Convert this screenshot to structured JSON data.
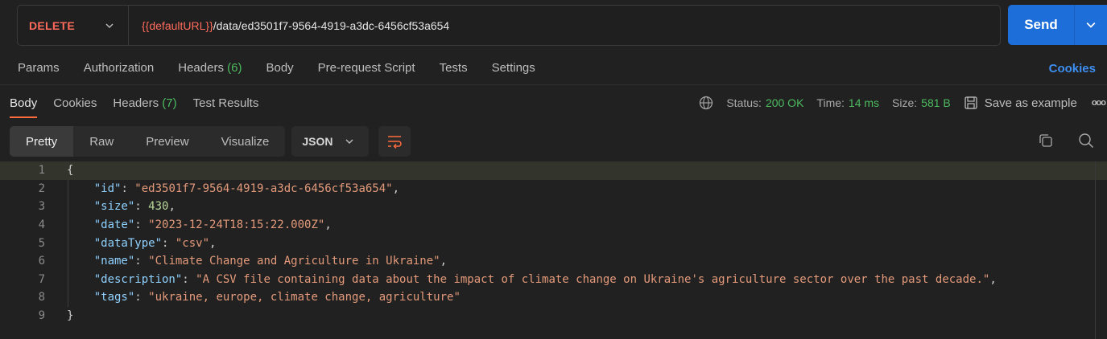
{
  "request": {
    "method": "DELETE",
    "url_variable": "{{defaultURL}}",
    "url_path": "/data/ed3501f7-9564-4919-a3dc-6456cf53a654",
    "send_label": "Send"
  },
  "request_tabs": {
    "params": "Params",
    "authorization": "Authorization",
    "headers": "Headers",
    "headers_count": "(6)",
    "body": "Body",
    "prerequest": "Pre-request Script",
    "tests": "Tests",
    "settings": "Settings",
    "cookies": "Cookies"
  },
  "response_tabs": {
    "body": "Body",
    "cookies": "Cookies",
    "headers": "Headers",
    "headers_count": "(7)",
    "test_results": "Test Results"
  },
  "response_meta": {
    "status_label": "Status:",
    "status_value": "200 OK",
    "time_label": "Time:",
    "time_value": "14 ms",
    "size_label": "Size:",
    "size_value": "581 B",
    "save_example": "Save as example",
    "more": "ooo"
  },
  "view_modes": [
    "Pretty",
    "Raw",
    "Preview",
    "Visualize"
  ],
  "format": "JSON",
  "icons": {
    "method_dropdown": "chevron-down-icon",
    "send_dropdown": "chevron-down-icon",
    "globe": "globe-icon",
    "save": "save-icon",
    "wrap": "wrap-lines-icon",
    "copy": "copy-icon",
    "search": "search-icon"
  },
  "colors": {
    "accent_blue": "#1d6ed8",
    "method_red": "#ff6b5b",
    "success_green": "#4dbb5f",
    "active_tab_underline": "#ff6b3d"
  },
  "code": {
    "line_numbers": [
      "1",
      "2",
      "3",
      "4",
      "5",
      "6",
      "7",
      "8",
      "9"
    ],
    "open_brace": "{",
    "close_brace": "}",
    "fields": [
      {
        "key": "\"id\"",
        "value": "\"ed3501f7-9564-4919-a3dc-6456cf53a654\"",
        "type": "string",
        "comma": ","
      },
      {
        "key": "\"size\"",
        "value": "430",
        "type": "number",
        "comma": ","
      },
      {
        "key": "\"date\"",
        "value": "\"2023-12-24T18:15:22.000Z\"",
        "type": "string",
        "comma": ","
      },
      {
        "key": "\"dataType\"",
        "value": "\"csv\"",
        "type": "string",
        "comma": ","
      },
      {
        "key": "\"name\"",
        "value": "\"Climate Change and Agriculture in Ukraine\"",
        "type": "string",
        "comma": ","
      },
      {
        "key": "\"description\"",
        "value": "\"A CSV file containing data about the impact of climate change on Ukraine's agriculture sector over the past decade.\"",
        "type": "string",
        "comma": ","
      },
      {
        "key": "\"tags\"",
        "value": "\"ukraine, europe, climate change, agriculture\"",
        "type": "string",
        "comma": ""
      }
    ]
  }
}
